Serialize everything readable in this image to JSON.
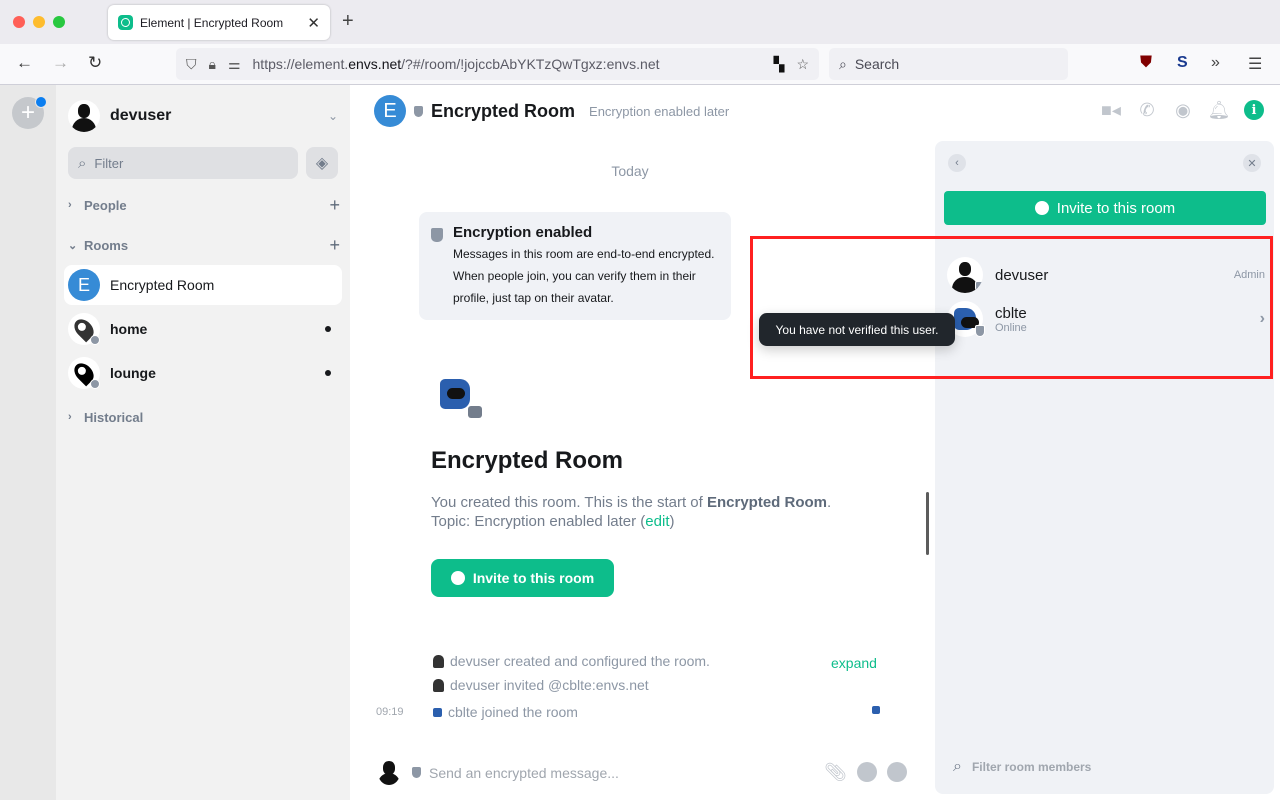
{
  "browser": {
    "tab_title": "Element | Encrypted Room",
    "url_prefix": "https://element.",
    "url_domain": "envs.net",
    "url_rest": "/?#/room/!jojccbAbYKTzQwTgxz:envs.net",
    "search_placeholder": "Search",
    "traffic_colors": [
      "#ff5f57",
      "#febc2e",
      "#28c840"
    ]
  },
  "sidebar": {
    "user": {
      "name": "devuser"
    },
    "filter_placeholder": "Filter",
    "sections": [
      {
        "label": "People",
        "expanded": false
      },
      {
        "label": "Rooms",
        "expanded": true
      },
      {
        "label": "Historical",
        "expanded": false
      }
    ],
    "rooms": [
      {
        "name": "Encrypted Room",
        "avatar_letter": "E",
        "active": true,
        "unread": false
      },
      {
        "name": "home",
        "active": false,
        "unread": true
      },
      {
        "name": "lounge",
        "active": false,
        "unread": true
      }
    ]
  },
  "room": {
    "avatar_letter": "E",
    "title": "Encrypted Room",
    "topic": "Encryption enabled later",
    "date_separator": "Today",
    "encryption_card": {
      "title": "Encryption enabled",
      "body": "Messages in this room are end-to-end encrypted. When people join, you can verify them in their profile, just tap on their avatar."
    },
    "new_room": {
      "title": "Encrypted Room",
      "text_prefix": "You created this room. This is the start of ",
      "text_room": "Encrypted Room",
      "text_suffix": ".",
      "topic_prefix": "Topic: Encryption enabled later (",
      "topic_link": "edit",
      "topic_suffix": ")",
      "invite_label": "Invite to this room"
    },
    "events": [
      {
        "text": "devuser created and configured the room."
      },
      {
        "text": "devuser invited @cblte:envs.net"
      },
      {
        "text": "cblte joined the room",
        "time": "09:19"
      }
    ],
    "expand_label": "expand",
    "composer_placeholder": "Send an encrypted message..."
  },
  "right_panel": {
    "invite_label": "Invite to this room",
    "members": [
      {
        "name": "devuser",
        "role": "Admin",
        "status": ""
      },
      {
        "name": "cblte",
        "role": "",
        "status": "Online"
      }
    ],
    "filter_placeholder": "Filter room members",
    "tooltip": "You have not verified this user."
  },
  "colors": {
    "accent": "#0dbd8b",
    "room_avatar": "#368bd6",
    "highlight": "#ff2020"
  }
}
